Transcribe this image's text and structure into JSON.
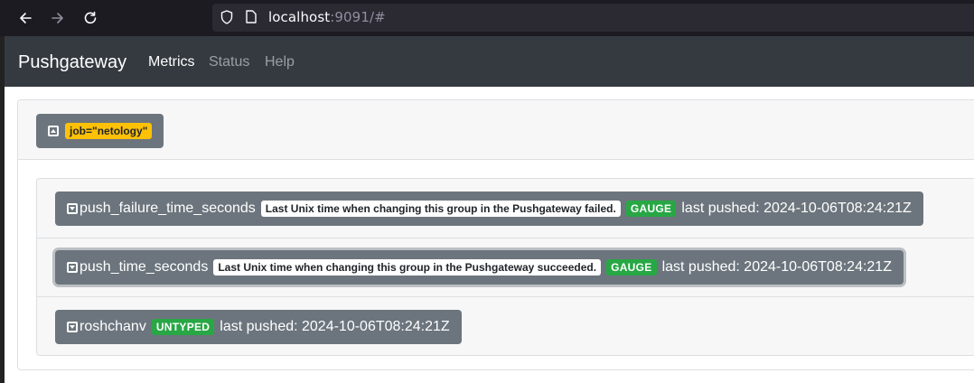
{
  "browser": {
    "url_host": "localhost",
    "url_rest": ":9091/#"
  },
  "navbar": {
    "brand": "Pushgateway",
    "links": [
      "Metrics",
      "Status",
      "Help"
    ]
  },
  "group": {
    "label": "job=\"netology\""
  },
  "metrics": [
    {
      "name": "push_failure_time_seconds",
      "help": "Last Unix time when changing this group in the Pushgateway failed.",
      "type": "GAUGE",
      "pushed": "last pushed: 2024-10-06T08:24:21Z"
    },
    {
      "name": "push_time_seconds",
      "help": "Last Unix time when changing this group in the Pushgateway succeeded.",
      "type": "GAUGE",
      "pushed": "last pushed: 2024-10-06T08:24:21Z"
    },
    {
      "name": "roshchanv",
      "type": "UNTYPED",
      "pushed": "last pushed: 2024-10-06T08:24:21Z"
    }
  ],
  "colors": {
    "navbar": "#343a40",
    "button": "#6c757d",
    "job_badge": "#ffc107",
    "type_badge": "#28a745"
  }
}
